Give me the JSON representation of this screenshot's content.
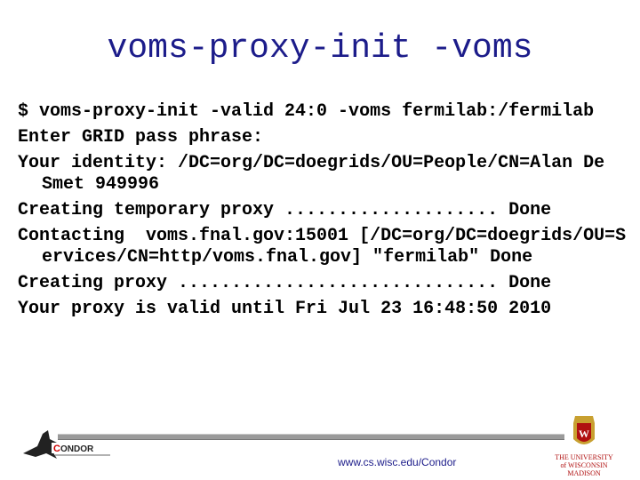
{
  "title": "voms-proxy-init -voms",
  "terminal_lines": [
    "$ voms-proxy-init -valid 24:0 -voms fermilab:/fermilab",
    "Enter GRID pass phrase:",
    "Your identity: /DC=org/DC=doegrids/OU=People/CN=Alan De Smet 949996",
    "Creating temporary proxy .................... Done",
    "Contacting  voms.fnal.gov:15001 [/DC=org/DC=doegrids/OU=Services/CN=http/voms.fnal.gov] \"fermilab\" Done",
    "Creating proxy .............................. Done",
    "Your proxy is valid until Fri Jul 23 16:48:50 2010"
  ],
  "footer": {
    "url": "www.cs.wisc.edu/Condor",
    "condor_logo_text": "CONDOR",
    "uw_logo_text": "THE UNIVERSITY of WISCONSIN MADISON"
  },
  "colors": {
    "title": "#1c1c8a",
    "url": "#1c1c8a"
  }
}
